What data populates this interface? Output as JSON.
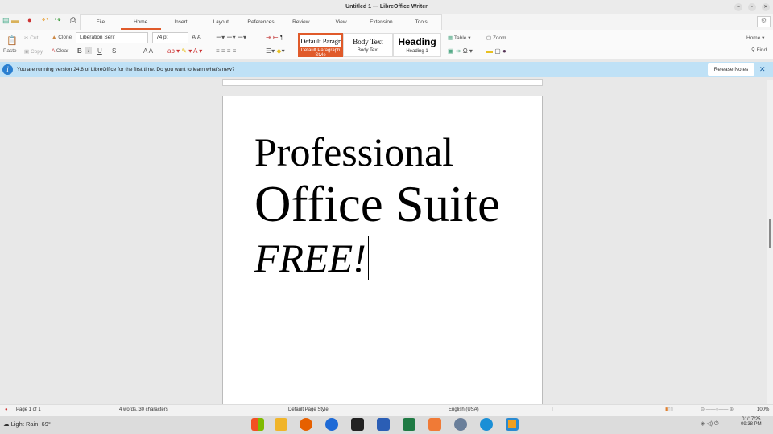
{
  "window": {
    "title": "Untitled 1 — LibreOffice Writer",
    "minimize": "–",
    "restore": "▫",
    "close": "✕"
  },
  "tabs": [
    {
      "label": "File"
    },
    {
      "label": "Home",
      "active": true
    },
    {
      "label": "Insert"
    },
    {
      "label": "Layout"
    },
    {
      "label": "References"
    },
    {
      "label": "Review"
    },
    {
      "label": "View"
    },
    {
      "label": "Extension"
    },
    {
      "label": "Tools"
    }
  ],
  "toolbar": {
    "paste": "Paste",
    "cut": "Cut",
    "copy": "Copy",
    "clone": "Clone",
    "clear": "Clear",
    "font_name": "Liberation Serif",
    "font_size": "74 pt",
    "bold": "B",
    "italic": "I",
    "underline": "U",
    "strike": "S",
    "table": "Table",
    "zoom": "Zoom",
    "home_dropdown": "Home",
    "find": "Find",
    "special_char": "Ω"
  },
  "styles": [
    {
      "preview": "Default Paragr",
      "label": "Default Paragraph Style",
      "active": true
    },
    {
      "preview": "Body Text",
      "label": "Body Text"
    },
    {
      "preview": "Heading",
      "label": "Heading 1"
    }
  ],
  "infobar": {
    "message": "You are running version 24.8 of LibreOffice for the first time. Do you want to learn what's new?",
    "button": "Release Notes",
    "close": "✕"
  },
  "document": {
    "lines": [
      "Professional",
      "Office Suite",
      "FREE!"
    ]
  },
  "statusbar": {
    "page": "Page 1 of 1",
    "words": "4 words, 30 characters",
    "page_style": "Default Page Style",
    "language": "English (USA)",
    "zoom": "100%"
  },
  "taskbar": {
    "weather": "Light Rain, 69°",
    "date": "01/17/25",
    "time": "09:38 PM"
  },
  "colors": {
    "accent": "#e05a2a",
    "infobar": "#bfe1f6"
  }
}
